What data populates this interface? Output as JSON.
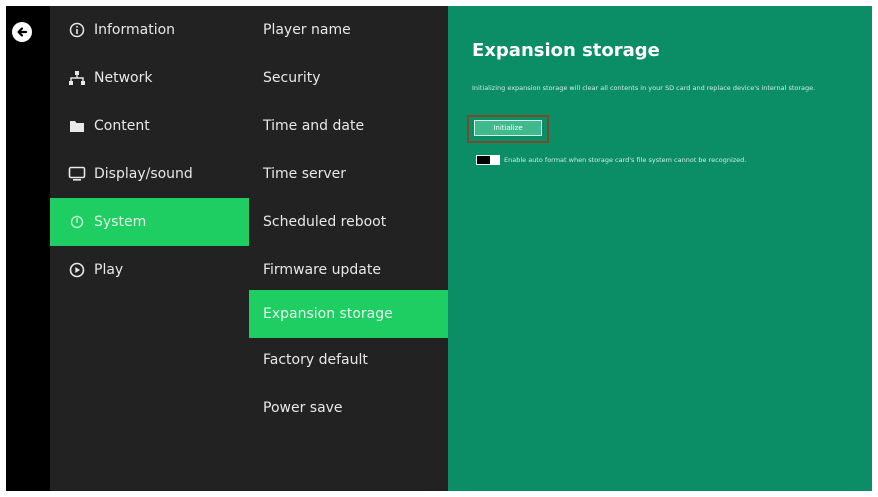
{
  "nav": {
    "back_icon": "back-arrow-circle-icon"
  },
  "menu": {
    "items": [
      {
        "label": "Information",
        "icon": "info-icon"
      },
      {
        "label": "Network",
        "icon": "network-icon"
      },
      {
        "label": "Content",
        "icon": "folder-icon"
      },
      {
        "label": "Display/sound",
        "icon": "monitor-icon"
      },
      {
        "label": "System",
        "icon": "system-icon",
        "selected": true
      },
      {
        "label": "Play",
        "icon": "play-circle-icon"
      }
    ]
  },
  "submenu": {
    "items": [
      {
        "label": "Player name"
      },
      {
        "label": "Security"
      },
      {
        "label": "Time and date"
      },
      {
        "label": "Time server"
      },
      {
        "label": "Scheduled reboot"
      },
      {
        "label": "Firmware update"
      },
      {
        "label": "Expansion storage",
        "selected": true
      },
      {
        "label": "Factory default"
      },
      {
        "label": "Power save"
      }
    ]
  },
  "content": {
    "title": "Expansion storage",
    "description": "Initializing expansion storage will clear all contents in your SD card and replace device's internal storage.",
    "initialize_label": "Initialize",
    "toggle_label": "Enable auto format when storage card's file system cannot be recognized.",
    "toggle_on": false
  },
  "colors": {
    "accent_green": "#1fce62",
    "content_bg": "#0b8e66",
    "menu_bg": "#222222",
    "highlight_outline": "#7a4a2c"
  }
}
